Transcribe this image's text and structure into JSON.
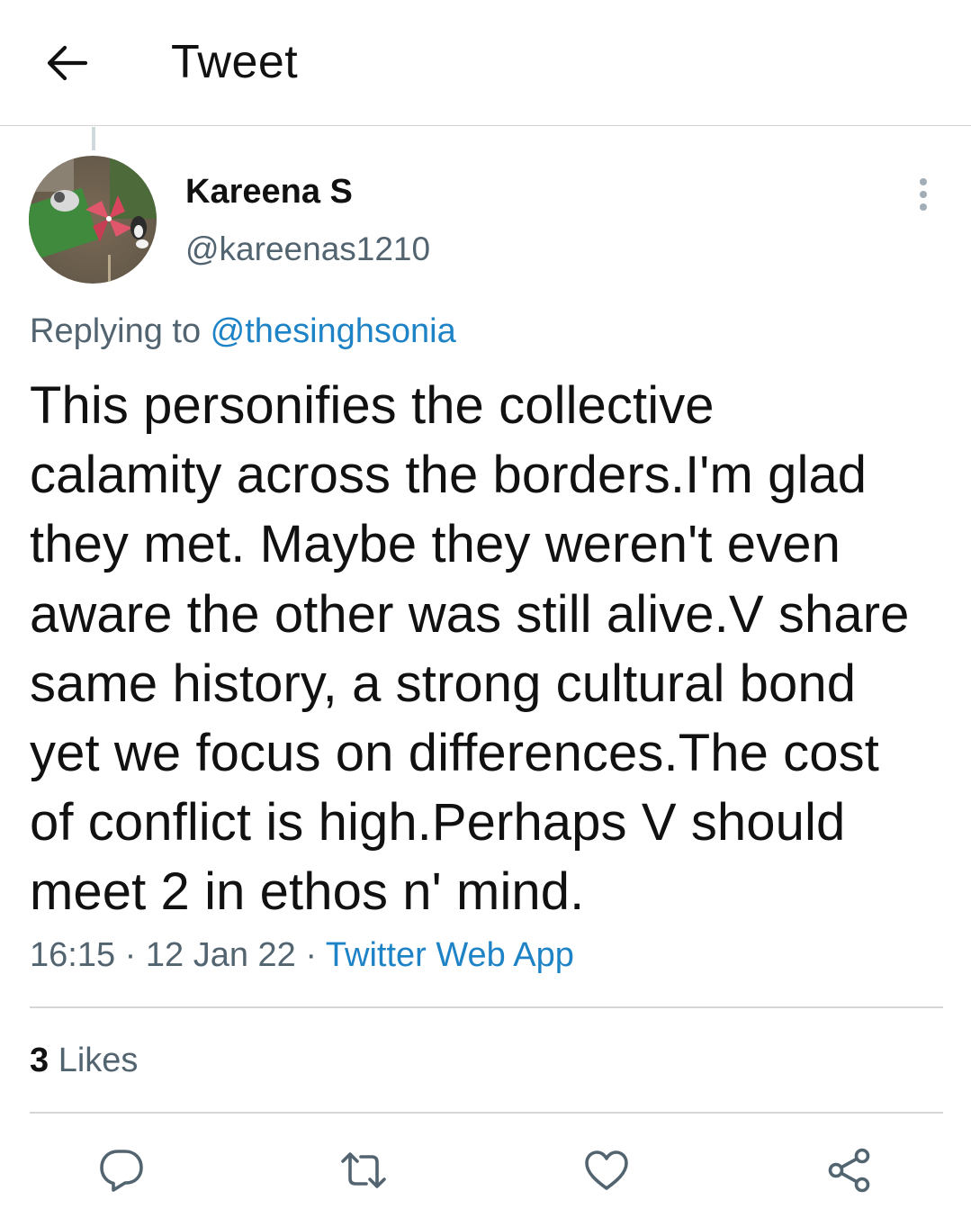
{
  "header": {
    "title": "Tweet"
  },
  "tweet": {
    "display_name": "Kareena S",
    "handle": "@kareenas1210",
    "replying_prefix": "Replying to ",
    "replying_to": "@thesinghsonia",
    "text_lines": [
      "This personifies the collective",
      "calamity across the borders.I'm glad",
      "they met. Maybe they weren't even",
      "aware the other was still alive.V share",
      "same history, a strong cultural bond",
      "yet we focus on differences.The cost",
      "of conflict is high.Perhaps V should",
      "meet 2 in ethos n' mind."
    ],
    "time": "16:15",
    "date": "12 Jan 22",
    "separator": " · ",
    "source": "Twitter Web App"
  },
  "stats": {
    "likes_count": "3",
    "likes_label": " Likes"
  },
  "actions": {
    "icons": [
      "reply-icon",
      "retweet-icon",
      "like-icon",
      "share-icon"
    ]
  },
  "colors": {
    "link": "#1d83c6",
    "secondary_text": "#536471",
    "icon": "#536471"
  }
}
